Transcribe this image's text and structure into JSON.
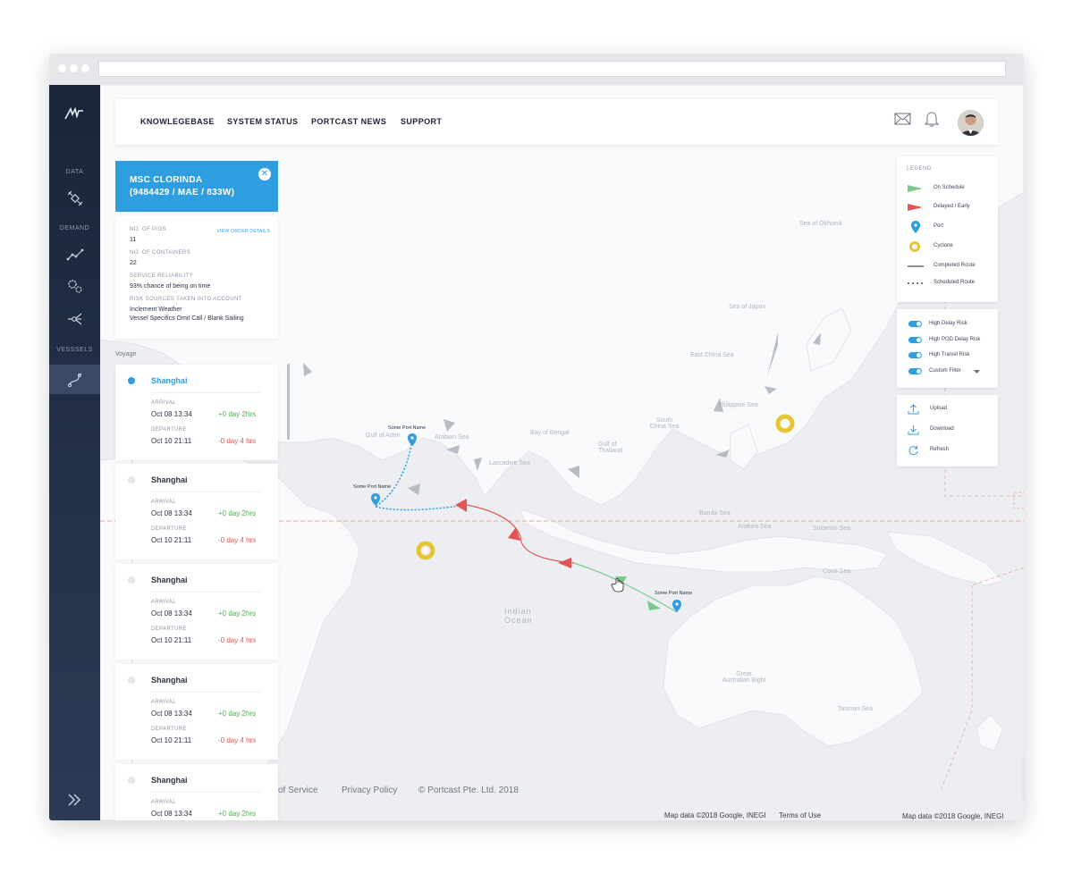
{
  "nav": {
    "items": [
      "KNOWLEGEBASE",
      "SYSTEM STATUS",
      "PORTCAST NEWS",
      "SUPPORT"
    ],
    "icons": [
      "mail-icon",
      "bell-icon"
    ]
  },
  "sidebar": {
    "sections": [
      "DATA",
      "DEMAND",
      "VESSSELS"
    ],
    "icons": [
      "satellite-icon",
      "trend-line-icon",
      "gears-icon",
      "network-icon",
      "vessel-route-icon"
    ],
    "expand_icon": "chevron-double-right-icon"
  },
  "vessel": {
    "name": "MSC CLORINDA",
    "code": "(9484429 / MAE / 833W)",
    "close_icon": "close-icon"
  },
  "details": {
    "view_order_link": "VIEW ORDER DETAILS",
    "fields": [
      {
        "label": "NO. OF P/OS",
        "value": "11"
      },
      {
        "label": "NO. OF CONTAINERS",
        "value": "22"
      },
      {
        "label": "SERVICE RELIABILITY",
        "value": "93% chance of being on time"
      },
      {
        "label": "RISK SOURCES TAKEN INTO ACCOUNT",
        "value": "Inclement Weather",
        "value2": "Vessel Specifics Omit Call / Blank Sailing"
      }
    ]
  },
  "voyage": {
    "label": "Voyage",
    "stops": [
      {
        "port": "Shanghai",
        "arrival_label": "ARRIVAL",
        "arrival": "Oct 08 13:34",
        "arrival_delta": "+0 day 2hrs",
        "departure_label": "DEPARTURE",
        "departure": "Oct 10 21:11",
        "departure_delta": "-0 day 4 hrs"
      },
      {
        "port": "Shanghai",
        "arrival_label": "ARRIVAL",
        "arrival": "Oct 08 13:34",
        "arrival_delta": "+0 day 2hrs",
        "departure_label": "DEPARTURE",
        "departure": "Oct 10 21:11",
        "departure_delta": "-0 day 4 hrs"
      },
      {
        "port": "Shanghai",
        "arrival_label": "ARRIVAL",
        "arrival": "Oct 08 13:34",
        "arrival_delta": "+0 day 2hrs",
        "departure_label": "DEPARTURE",
        "departure": "Oct 10 21:11",
        "departure_delta": "-0 day 4 hrs"
      },
      {
        "port": "Shanghai",
        "arrival_label": "ARRIVAL",
        "arrival": "Oct 08 13:34",
        "arrival_delta": "+0 day 2hrs",
        "departure_label": "DEPARTURE",
        "departure": "Oct 10 21:11",
        "departure_delta": "-0 day 4 hrs"
      },
      {
        "port": "Shanghai",
        "arrival_label": "ARRIVAL",
        "arrival": "Oct 08 13:34",
        "arrival_delta": "+0 day 2hrs"
      }
    ]
  },
  "legend": {
    "title": "LEGEND",
    "items": [
      "On Schedule",
      "Delayed / Early",
      "Port",
      "Cyclone",
      "Completed Route",
      "Scheduled Route"
    ]
  },
  "filters": [
    "High Delay Risk",
    "High POD Delay Risk",
    "High Transit Risk",
    "Custom Filter"
  ],
  "actions": [
    "Upload",
    "Download",
    "Refresh"
  ],
  "map": {
    "port_label": "Some Port Name",
    "labels": [
      "Sea of Okhotsk",
      "Sea of Japan",
      "East China Sea",
      "Philippine Sea",
      "South China Sea",
      "Bay of Bengal",
      "Arabian Sea",
      "Gulf of Aden",
      "Gulf of Thailand",
      "Laccadive Sea",
      "Banda Sea",
      "Arafura Sea",
      "Solomon Sea",
      "Coral Sea",
      "Indian Ocean",
      "Great Australian Bight",
      "Tasman Sea"
    ],
    "footer": [
      "of Service",
      "Privacy Policy",
      "© Portcast Pte. Ltd. 2018"
    ],
    "attribution": [
      "Map data ©2018 Google, INEGI",
      "Terms of Use",
      "Map data ©2018 Google, INEGI"
    ],
    "zoom": [
      "+",
      "−"
    ],
    "colors": {
      "on_schedule": "#7bc98b",
      "delayed": "#e25555",
      "port": "#2e9ee0",
      "cyclone": "#e5c534",
      "vessel": "#b7bcc5"
    }
  }
}
